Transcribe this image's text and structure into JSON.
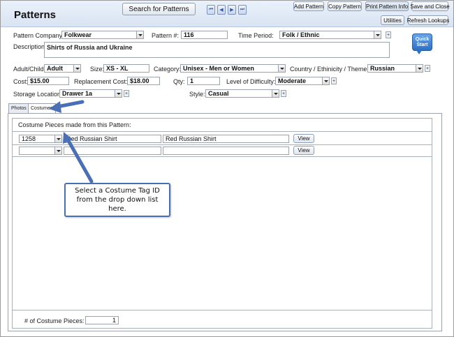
{
  "header": {
    "title": "Patterns",
    "search_label": "Search for Patterns",
    "nav": [
      "⏮",
      "◀",
      "▶",
      "⏭"
    ],
    "add_pattern": "Add Pattern",
    "copy_pattern": "Copy Pattern",
    "print_pattern_info": "Print Pattern Info",
    "save_and_close": "Save and Close",
    "utilities": "Utilities",
    "refresh_lookups": "Refresh Lookups"
  },
  "quick_start": "Quick Start",
  "form": {
    "pattern_company_label": "Pattern Company:",
    "pattern_company": "Folkwear",
    "pattern_num_label": "Pattern #:",
    "pattern_num": "116",
    "time_period_label": "Time Period:",
    "time_period": "Folk / Ethnic",
    "description_label": "Description:",
    "description": "Shirts of Russia and Ukraine",
    "adult_child_label": "Adult/Child",
    "adult_child": "Adult",
    "size_label": "Size:",
    "size": "XS - XL",
    "category_label": "Category:",
    "category": "Unisex - Men or Women",
    "country_label": "Country / Ethinicity / Theme:",
    "country": "Russian",
    "cost_label": "Cost:",
    "cost": "$15.00",
    "replacement_cost_label": "Replacement Cost:",
    "replacement_cost": "$18.00",
    "qty_label": "Qty:",
    "qty": "1",
    "difficulty_label": "Level of Difficulty:",
    "difficulty": "Moderate",
    "storage_label": "Storage Location:",
    "storage": "Drawer 1a",
    "style_label": "Style:",
    "style": "Casual"
  },
  "tabs": [
    {
      "label": "Photos"
    },
    {
      "label": "Costumes"
    }
  ],
  "costumes": {
    "heading": "Costume Pieces made from this Pattern:",
    "rows": [
      {
        "tag_id": "1258",
        "name": "Red Russian Shirt",
        "description": "Red Russian Shirt",
        "view_label": "View"
      },
      {
        "tag_id": "",
        "name": "",
        "description": "",
        "view_label": "View"
      }
    ],
    "count_label": "# of Costume Pieces:",
    "count": "1"
  },
  "callout_text": "Select a Costume Tag ID from the drop down list here.",
  "colors": {
    "accent": "#4a6fb5",
    "quick_start": "#2f6fc0"
  }
}
